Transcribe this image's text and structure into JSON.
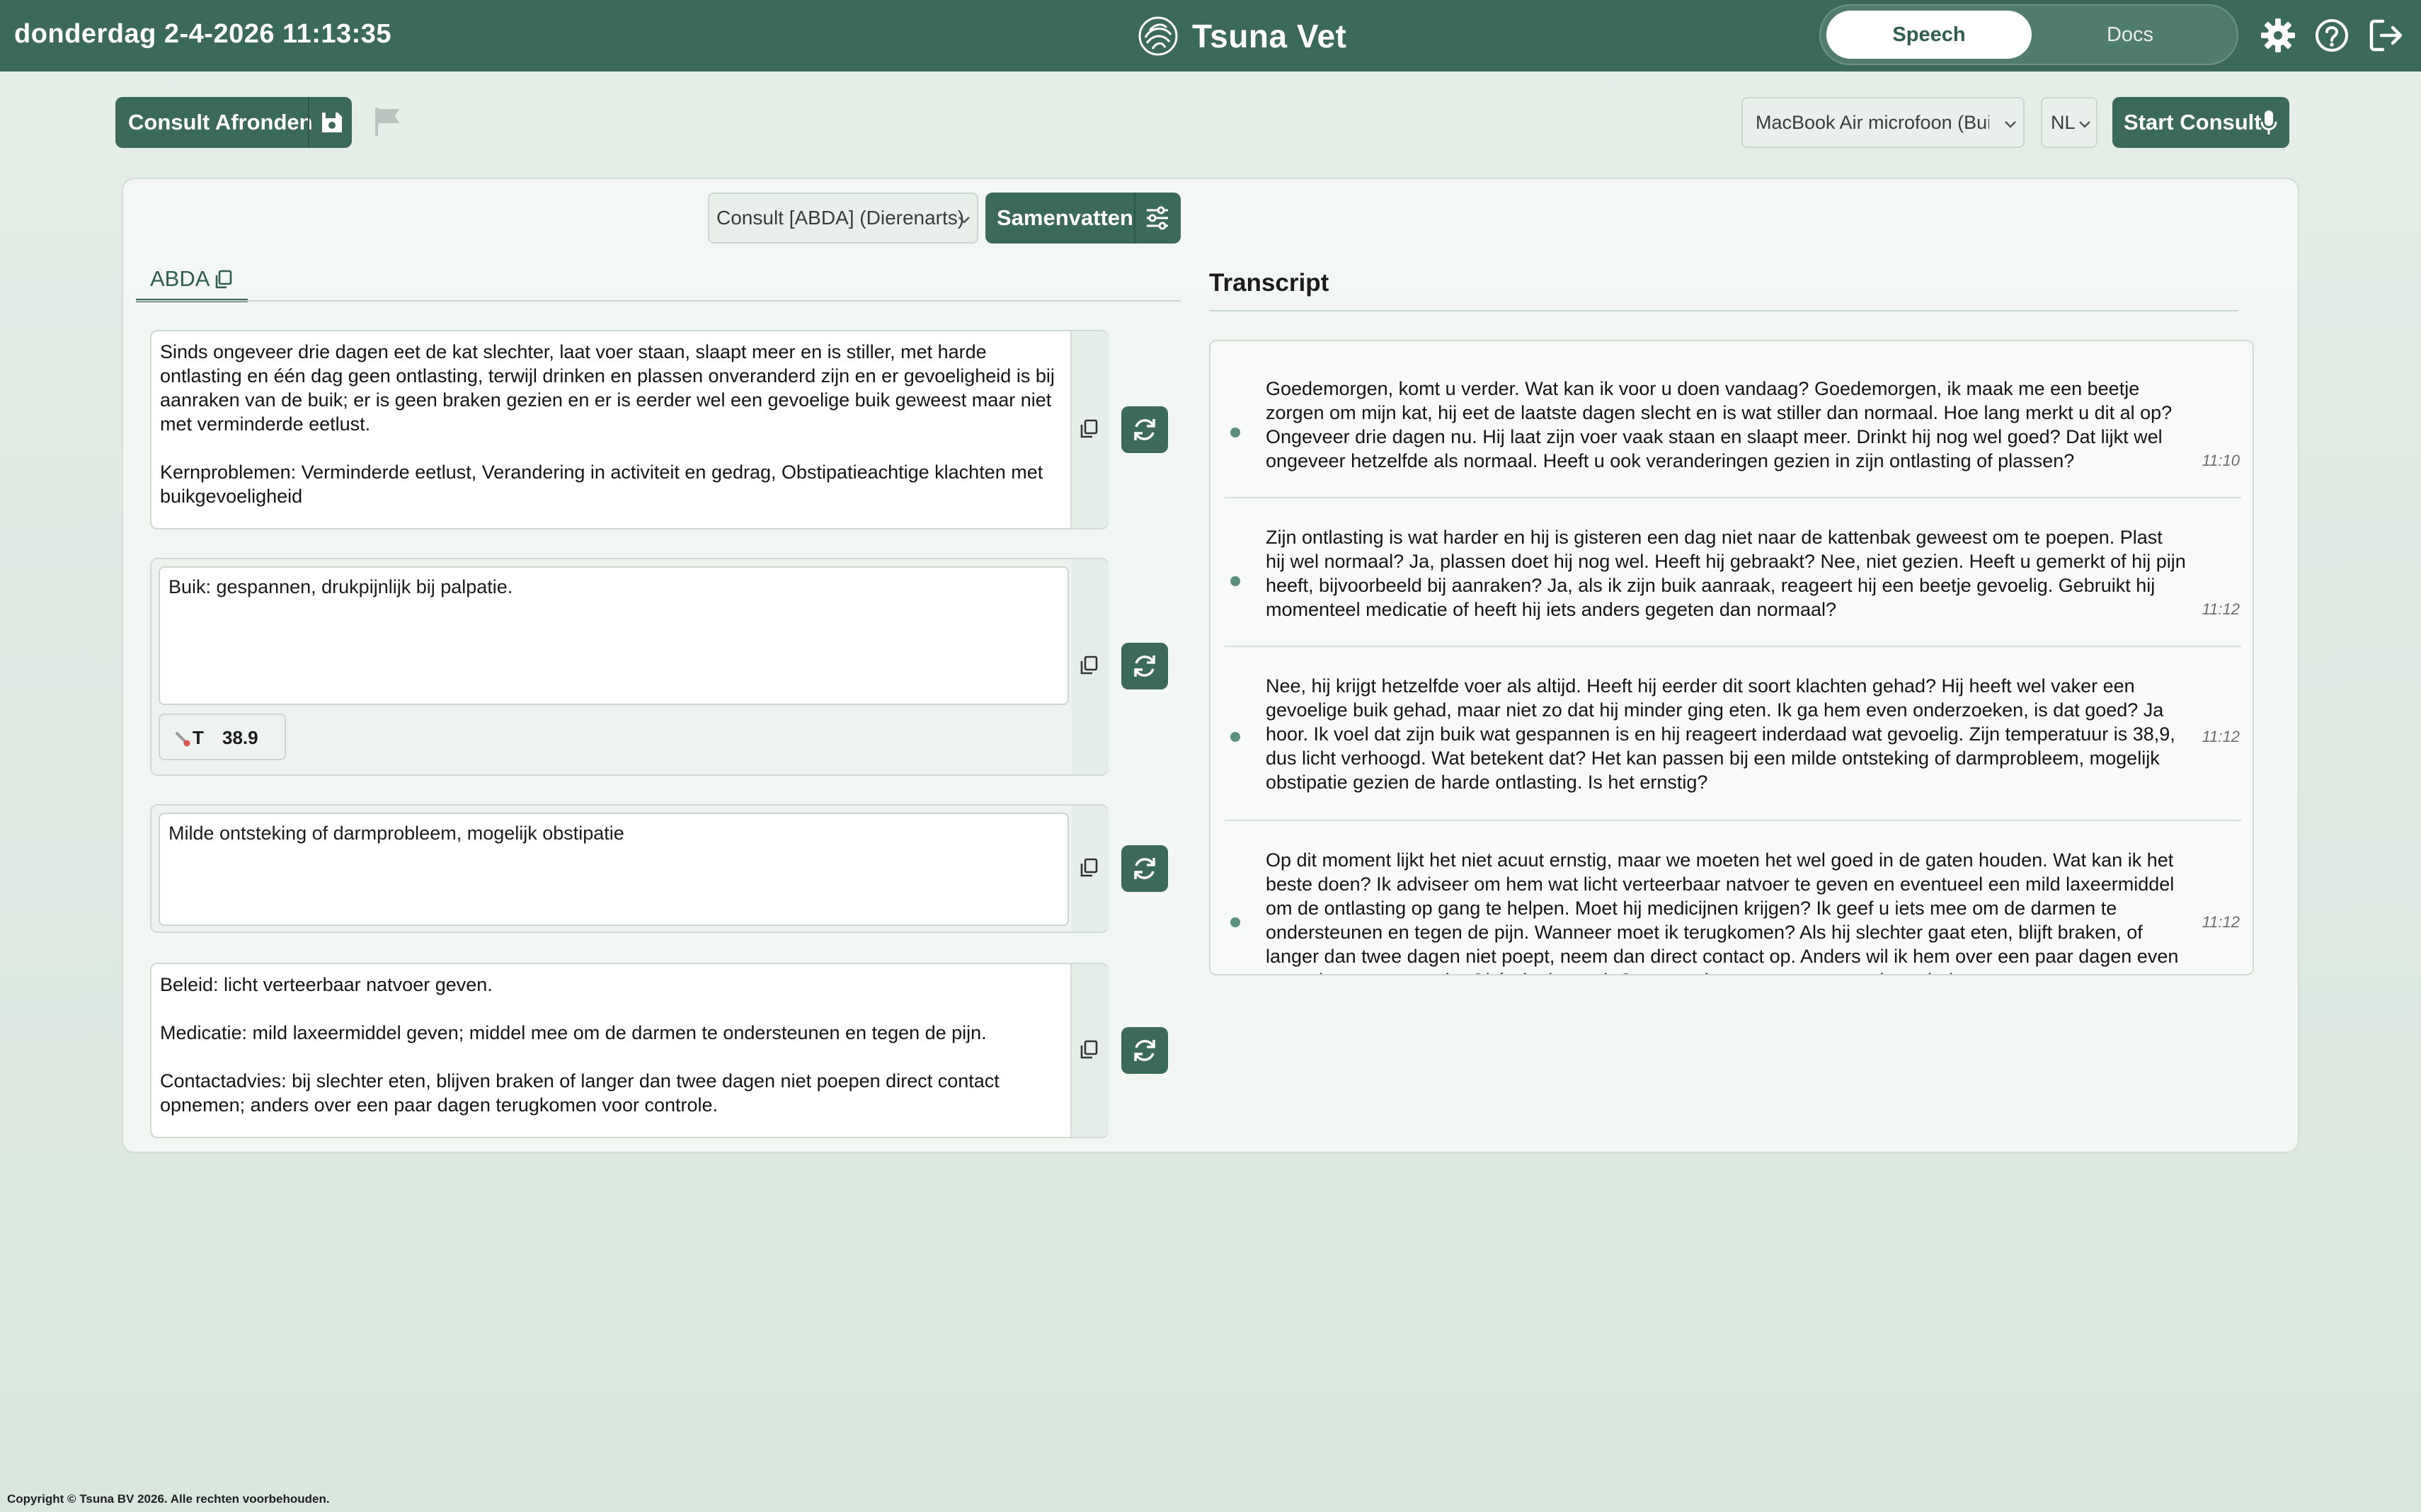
{
  "header": {
    "datetime": "donderdag 2-4-2026 11:13:35",
    "app_name": "Tsuna Vet",
    "mode_tabs": [
      "Speech",
      "Docs"
    ],
    "active_mode": "Speech",
    "icons": [
      "gear-icon",
      "help-icon",
      "logout-icon"
    ]
  },
  "toolbar": {
    "consult_afronden_label": "Consult Afronden",
    "save_icon": "save-icon",
    "flag_icon": "flag-icon",
    "microphone_value": "MacBook Air microfoon (Built-in)",
    "language_value": "NL",
    "start_consult_label": "Start Consult"
  },
  "summary": {
    "template_value": "Consult [ABDA] (Dierenarts)",
    "samenvatten_label": "Samenvatten",
    "tab_label": "ABDA",
    "sections": [
      {
        "text": "Sinds ongeveer drie dagen eet de kat slechter, laat voer staan, slaapt meer en is stiller, met harde ontlasting en één dag geen ontlasting, terwijl drinken en plassen onveranderd zijn en er gevoeligheid is bij aanraken van de buik; er is geen braken gezien en er is eerder wel een gevoelige buik geweest maar niet met verminderde eetlust.\n\nKernproblemen: Verminderde eetlust, Verandering in activiteit en gedrag, Obstipatieachtige klachten met buikgevoeligheid"
      },
      {
        "text": "Buik: gespannen, drukpijnlijk bij palpatie.",
        "vital_label": "T",
        "vital_value": "38.9"
      },
      {
        "text": "Milde ontsteking of darmprobleem, mogelijk obstipatie"
      },
      {
        "text": "Beleid: licht verteerbaar natvoer geven.\n\nMedicatie: mild laxeermiddel geven; middel mee om de darmen te ondersteunen en tegen de pijn.\n\nContactadvies: bij slechter eten, blijven braken of langer dan twee dagen niet poepen direct contact opnemen; anders over een paar dagen terugkomen voor controle."
      }
    ]
  },
  "transcript": {
    "title": "Transcript",
    "items": [
      {
        "text": "Goedemorgen, komt u verder. Wat kan ik voor u doen vandaag? Goedemorgen, ik maak me een beetje zorgen om mijn kat, hij eet de laatste dagen slecht en is wat stiller dan normaal. Hoe lang merkt u dit al op? Ongeveer drie dagen nu. Hij laat zijn voer vaak staan en slaapt meer. Drinkt hij nog wel goed? Dat lijkt wel ongeveer hetzelfde als normaal. Heeft u ook veranderingen gezien in zijn ontlasting of plassen?",
        "time": "11:10"
      },
      {
        "text": "Zijn ontlasting is wat harder en hij is gisteren een dag niet naar de kattenbak geweest om te poepen. Plast hij wel normaal? Ja, plassen doet hij nog wel. Heeft hij gebraakt? Nee, niet gezien. Heeft u gemerkt of hij pijn heeft, bijvoorbeeld bij aanraken? Ja, als ik zijn buik aanraak, reageert hij een beetje gevoelig. Gebruikt hij momenteel medicatie of heeft hij iets anders gegeten dan normaal?",
        "time": "11:12"
      },
      {
        "text": "Nee, hij krijgt hetzelfde voer als altijd. Heeft hij eerder dit soort klachten gehad? Hij heeft wel vaker een gevoelige buik gehad, maar niet zo dat hij minder ging eten. Ik ga hem even onderzoeken, is dat goed? Ja hoor. Ik voel dat zijn buik wat gespannen is en hij reageert inderdaad wat gevoelig. Zijn temperatuur is 38,9, dus licht verhoogd. Wat betekent dat? Het kan passen bij een milde ontsteking of darmprobleem, mogelijk obstipatie gezien de harde ontlasting. Is het ernstig?",
        "time": "11:12"
      },
      {
        "text": "Op dit moment lijkt het niet acuut ernstig, maar we moeten het wel goed in de gaten houden. Wat kan ik het beste doen? Ik adviseer om hem wat licht verteerbaar natvoer te geven en eventueel een mild laxeermiddel om de ontlasting op gang te helpen. Moet hij medicijnen krijgen? Ik geef u iets mee om de darmen te ondersteunen en tegen de pijn. Wanneer moet ik terugkomen? Als hij slechter gaat eten, blijft braken, of langer dan twee dagen niet poept, neem dan direct contact op. Anders wil ik hem over een paar dagen even terugzien voor controle. Oké, dank u wel. Graag gedaan, en succes met hem thuis.",
        "time": "11:12"
      }
    ]
  },
  "footer": {
    "copyright": "Copyright © Tsuna BV 2026. Alle rechten voorbehouden."
  }
}
